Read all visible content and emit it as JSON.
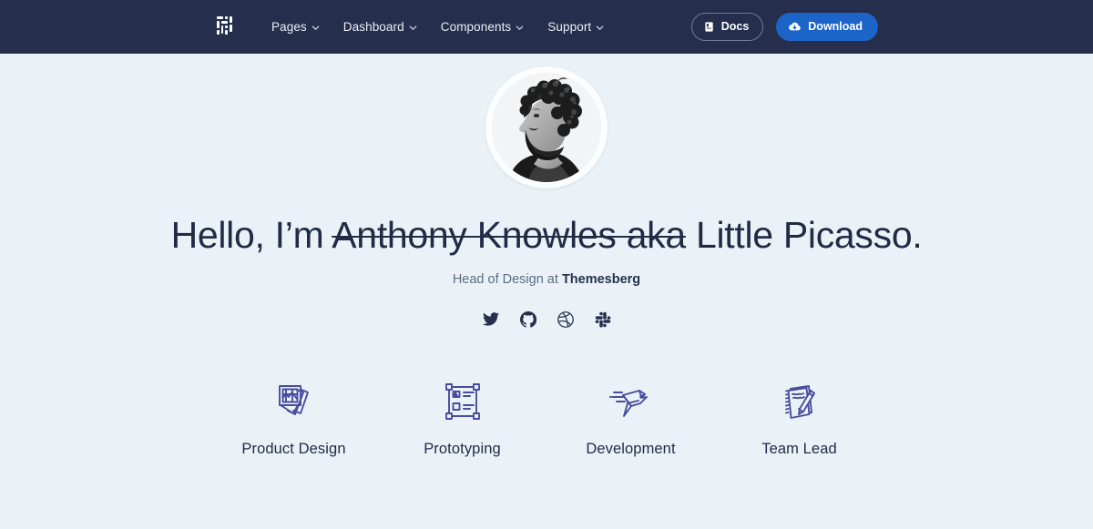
{
  "theme": {
    "navbar_bg": "#262e4e",
    "page_bg": "#ebf2f7",
    "accent_blue": "#1d64c8",
    "text_dark": "#212b45",
    "text_muted": "#5d6b85",
    "icon_indigo": "#474d9c"
  },
  "navbar": {
    "brand_name": "themesberg-logo",
    "links": [
      {
        "label": "Pages",
        "icon": "chevron-down-icon"
      },
      {
        "label": "Dashboard",
        "icon": "chevron-down-icon"
      },
      {
        "label": "Components",
        "icon": "chevron-down-icon"
      },
      {
        "label": "Support",
        "icon": "chevron-down-icon"
      }
    ],
    "docs_button": {
      "label": "Docs",
      "icon": "book-icon"
    },
    "download_button": {
      "label": "Download",
      "icon": "cloud-download-icon"
    }
  },
  "hero": {
    "avatar_alt": "profile-portrait",
    "headline": {
      "prefix": "Hello, I’m ",
      "struck": "Anthony Knowles aka",
      "suffix": " Little Picasso."
    },
    "subtitle": {
      "prefix": "Head of Design at ",
      "company": "Themesberg"
    },
    "socials": [
      {
        "name": "twitter-icon",
        "label": "Twitter"
      },
      {
        "name": "github-icon",
        "label": "GitHub"
      },
      {
        "name": "dribbble-icon",
        "label": "Dribbble"
      },
      {
        "name": "slack-icon",
        "label": "Slack"
      }
    ]
  },
  "features": [
    {
      "label": "Product Design",
      "icon": "photos-stack-icon"
    },
    {
      "label": "Prototyping",
      "icon": "artboard-wireframe-icon"
    },
    {
      "label": "Development",
      "icon": "origami-bird-icon"
    },
    {
      "label": "Team Lead",
      "icon": "notepad-pencil-icon"
    }
  ]
}
